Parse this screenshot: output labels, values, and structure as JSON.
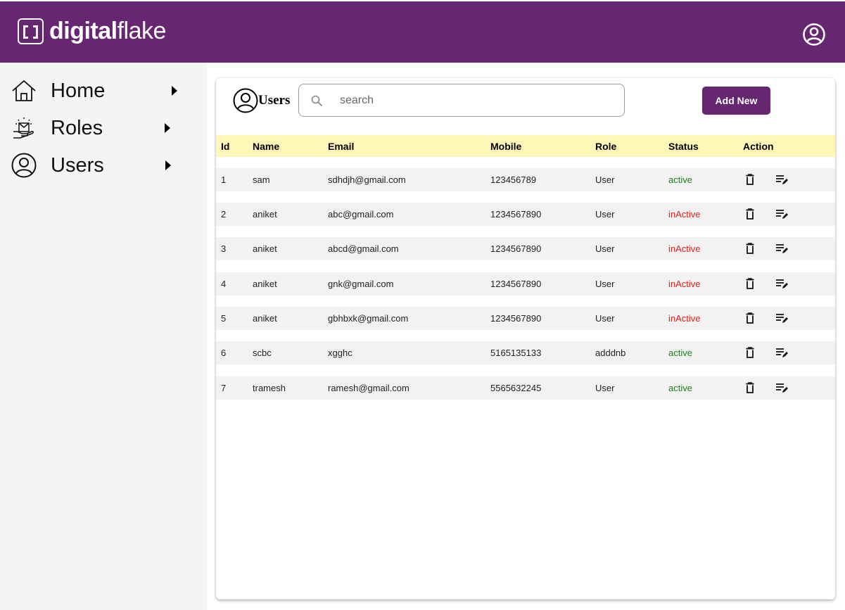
{
  "header": {
    "logo_bold": "digital",
    "logo_light": "flake",
    "brand_color": "#662671"
  },
  "sidebar": {
    "items": [
      {
        "label": "Home",
        "icon": "home-icon"
      },
      {
        "label": "Roles",
        "icon": "roles-icon"
      },
      {
        "label": "Users",
        "icon": "user-circle-icon"
      }
    ]
  },
  "users_panel": {
    "title": "Users",
    "search": {
      "placeholder": "search",
      "value": ""
    },
    "add_button": "Add New",
    "columns": [
      "Id",
      "Name",
      "Email",
      "Mobile",
      "Role",
      "Status",
      "Action"
    ],
    "rows": [
      {
        "id": "1",
        "name": "sam",
        "email": "sdhdjh@gmail.com",
        "mobile": "123456789",
        "role": "User",
        "status": "active"
      },
      {
        "id": "2",
        "name": "aniket",
        "email": "abc@gmail.com",
        "mobile": "1234567890",
        "role": "User",
        "status": "inActive"
      },
      {
        "id": "3",
        "name": "aniket",
        "email": "abcd@gmail.com",
        "mobile": "1234567890",
        "role": "User",
        "status": "inActive"
      },
      {
        "id": "4",
        "name": "aniket",
        "email": "gnk@gmail.com",
        "mobile": "1234567890",
        "role": "User",
        "status": "inActive"
      },
      {
        "id": "5",
        "name": "aniket",
        "email": "gbhbxk@gmail.com",
        "mobile": "1234567890",
        "role": "User",
        "status": "inActive"
      },
      {
        "id": "6",
        "name": "scbc",
        "email": "xgghc",
        "mobile": "5165135133",
        "role": "adddnb",
        "status": "active"
      },
      {
        "id": "7",
        "name": "tramesh",
        "email": "ramesh@gmail.com",
        "mobile": "5565632245",
        "role": "User",
        "status": "active"
      }
    ],
    "status_colors": {
      "active": "#1d7d1d",
      "inActive": "#e0201b"
    },
    "header_bg": "#fff7b8",
    "row_bg": "#f2f2f2"
  }
}
